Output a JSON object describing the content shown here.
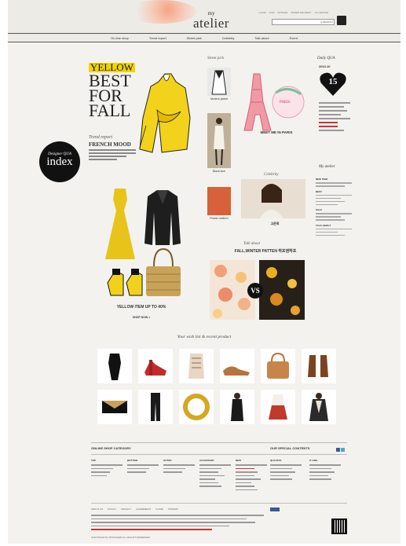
{
  "header": {
    "logo_small": "my",
    "logo_main": "atelier",
    "util_links": [
      "LOGIN",
      "JOIN",
      "MYPAGE",
      "ORDER DELIVERY",
      "CS CENTER"
    ],
    "search_placeholder": "",
    "search_button": "Q  SEARCH"
  },
  "nav": {
    "items": [
      "On-line shop",
      "Trend report",
      "Street pick",
      "Celebrity",
      "Talk about",
      "Event"
    ]
  },
  "trend": {
    "tag": "YELLOW",
    "headline_line1": "BEST",
    "headline_line2": "FOR",
    "headline_line3": "FALL",
    "subtitle": "Trend report",
    "subheading": "FRENCH MOOD"
  },
  "index_badge": {
    "small": "Designer QUA",
    "big": "index"
  },
  "street_pick": {
    "title": "Street pick",
    "items": [
      {
        "caption": "Modern jacket"
      },
      {
        "caption": "Black lace"
      },
      {
        "caption": "Flower uniform"
      }
    ]
  },
  "paris": {
    "banner": "PARIS",
    "caption": "MEET ME IN PARIS"
  },
  "celebrity": {
    "title": "Celebrity",
    "caption": "고준희"
  },
  "sidebar": {
    "daily_title": "Daily QUA",
    "date_label": "2013.10",
    "heart_number": "15",
    "myatelier_title": "My atelier",
    "sections": [
      "NEW ITEM",
      "BEST",
      "SALE",
      "TALK ABOUT"
    ]
  },
  "yellow_item": {
    "title": "YELLOW ITEM UP TO 40%",
    "subtitle": "",
    "shop_now": "SHOP NOW >"
  },
  "talk": {
    "title": "Talk about",
    "headline": "FALL,WINTER PATTEN 하프앤하프",
    "vs": "VS",
    "left_caption": "",
    "right_caption": ""
  },
  "wishlist": {
    "title": "Your wish list & recent product"
  },
  "footer": {
    "category_title": "ONLINE SHOP CATEGORY",
    "special_title": "OUR SPECIAL CONTENTS",
    "columns": [
      "TOP",
      "BOTTOM",
      "OUTER",
      "ACCESSORY",
      "NEW"
    ],
    "special_columns": [
      "QUA PICK",
      "IT GIRL"
    ],
    "links": [
      "ABOUT US",
      "POLICY",
      "PRIVACY",
      "AGREEMENT",
      "GUIDE",
      "SITEMAP"
    ],
    "copyright": "COPYRIGHT(C) MYATELIER ALL RIGHTS RESERVED",
    "fb_like_text": ""
  },
  "colors": {
    "accent_yellow": "#f2d400",
    "background": "#f3f2ee",
    "dark": "#111111"
  }
}
